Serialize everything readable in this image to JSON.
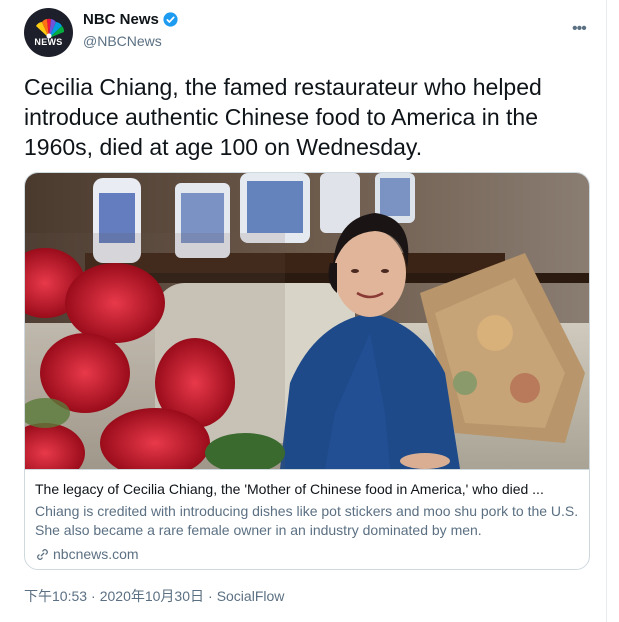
{
  "author": {
    "display_name": "NBC News",
    "handle": "@NBCNews",
    "avatar_text": "NEWS",
    "verified": true
  },
  "tweet": {
    "text": "Cecilia Chiang, the famed restaurateur who helped introduce authentic Chinese food to America in the 1960s, died at age 100 on Wednesday."
  },
  "link_card": {
    "title": "The legacy of Cecilia Chiang, the 'Mother of Chinese food in America,' who died ...",
    "description": "Chiang is credited with introducing dishes like pot stickers and moo shu pork to the U.S. She also became a rare female owner in an industry dominated by men.",
    "domain": "nbcnews.com"
  },
  "meta": {
    "time": "下午10:53",
    "separator": "·",
    "date": "2020年10月30日",
    "source": "SocialFlow"
  },
  "colors": {
    "verified_blue": "#1d9bf0",
    "secondary_text": "#5b7083",
    "border": "#cfd9de"
  }
}
